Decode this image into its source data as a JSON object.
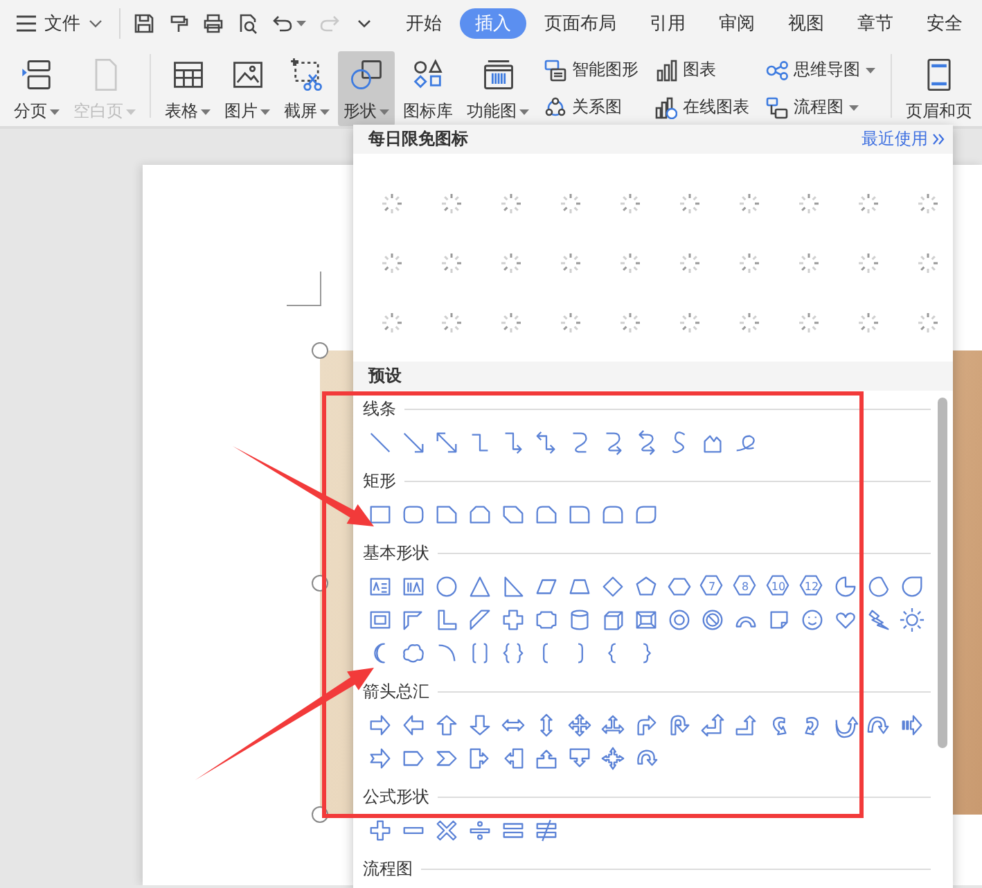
{
  "menu": {
    "label": "文件"
  },
  "quick_access": [
    {
      "kind": "save",
      "disabled": false
    },
    {
      "kind": "format-painter",
      "disabled": false
    },
    {
      "kind": "print",
      "disabled": false
    },
    {
      "kind": "print-preview",
      "disabled": false
    },
    {
      "kind": "undo",
      "disabled": false
    },
    {
      "kind": "redo",
      "disabled": true
    },
    {
      "kind": "customize",
      "disabled": false
    }
  ],
  "tabs": [
    {
      "label": "开始",
      "selected": false
    },
    {
      "label": "插入",
      "selected": true
    },
    {
      "label": "页面布局",
      "selected": false
    },
    {
      "label": "引用",
      "selected": false
    },
    {
      "label": "审阅",
      "selected": false
    },
    {
      "label": "视图",
      "selected": false
    },
    {
      "label": "章节",
      "selected": false
    },
    {
      "label": "安全",
      "selected": false
    }
  ],
  "ribbon": [
    [
      {
        "label": "分页",
        "kind": "page-break",
        "dropdown": true,
        "disabled": false,
        "selected": false
      },
      {
        "label": "空白页",
        "kind": "blank-page",
        "dropdown": true,
        "disabled": true,
        "selected": false
      }
    ],
    [
      {
        "label": "表格",
        "kind": "table",
        "dropdown": true,
        "disabled": false,
        "selected": false
      },
      {
        "label": "图片",
        "kind": "picture",
        "dropdown": true,
        "disabled": false,
        "selected": false
      },
      {
        "label": "截屏",
        "kind": "screenshot",
        "dropdown": true,
        "disabled": false,
        "selected": false
      },
      {
        "label": "形状",
        "kind": "shapes",
        "dropdown": true,
        "disabled": false,
        "selected": true
      },
      {
        "label": "图标库",
        "kind": "icon-library",
        "dropdown": false,
        "disabled": false,
        "selected": false
      },
      {
        "label": "功能图",
        "kind": "function-chart",
        "dropdown": true,
        "disabled": false,
        "selected": false
      },
      {
        "stack": [
          {
            "label": "智能图形",
            "kind": "smart-graphic",
            "dropdown": false
          },
          {
            "label": "关系图",
            "kind": "relation",
            "dropdown": false
          }
        ]
      },
      {
        "stack": [
          {
            "label": "图表",
            "kind": "chart",
            "dropdown": false
          },
          {
            "label": "在线图表",
            "kind": "online-chart",
            "dropdown": false
          }
        ]
      },
      {
        "stack": [
          {
            "label": "思维导图",
            "kind": "mind-map",
            "dropdown": true
          },
          {
            "label": "流程图",
            "kind": "flowchart",
            "dropdown": true
          }
        ]
      }
    ],
    [
      {
        "label": "页眉和页",
        "kind": "header-footer",
        "dropdown": false,
        "disabled": false,
        "selected": false
      }
    ]
  ],
  "shape_panel": {
    "title": "每日限免图标",
    "recent_link": "最近使用",
    "free_icons": {
      "kind": "loading"
    },
    "preset_title": "预设",
    "sections": [
      {
        "title": "线条",
        "kind": "lines"
      },
      {
        "title": "矩形",
        "kind": "rectangles"
      },
      {
        "title": "基本形状",
        "kind": "basic",
        "numbers": [
          "7",
          "8",
          "10",
          "12"
        ]
      },
      {
        "title": "箭头总汇",
        "kind": "arrows"
      },
      {
        "title": "公式形状",
        "kind": "equation"
      },
      {
        "title": "流程图",
        "kind": "flowchart"
      }
    ]
  }
}
